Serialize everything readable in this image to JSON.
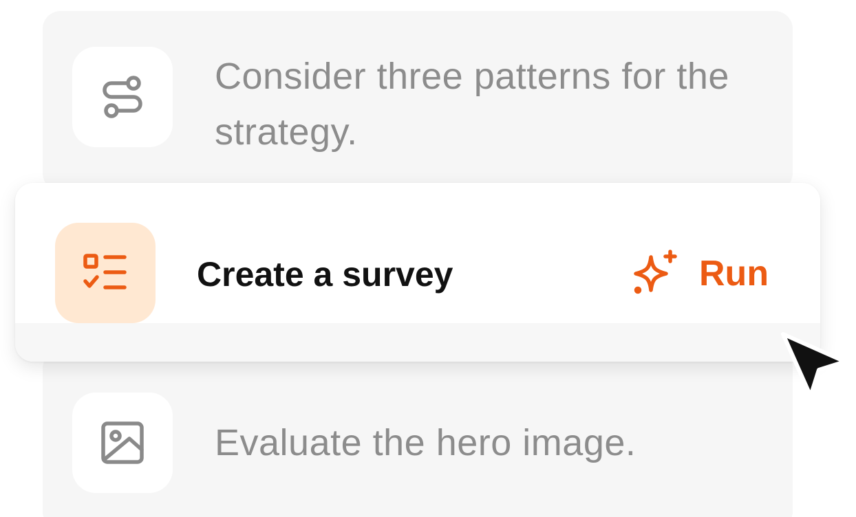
{
  "tasks": [
    {
      "text": "Consider three patterns for the strategy.",
      "icon": "route-icon",
      "state": "inactive"
    },
    {
      "text": "Create a survey",
      "icon": "checklist-icon",
      "state": "active",
      "action_label": "Run",
      "action_icon": "sparkles-icon"
    },
    {
      "text": "Evaluate the hero image.",
      "icon": "image-icon",
      "state": "inactive"
    }
  ],
  "colors": {
    "accent": "#ec5b13",
    "accent_tile": "#ffe8d2",
    "inactive_text": "#8c8c8c",
    "inactive_icon": "#8a8a8a",
    "card_bg": "#f6f6f6",
    "title_text": "#111111"
  },
  "cursor": "arrow-pointer-icon"
}
